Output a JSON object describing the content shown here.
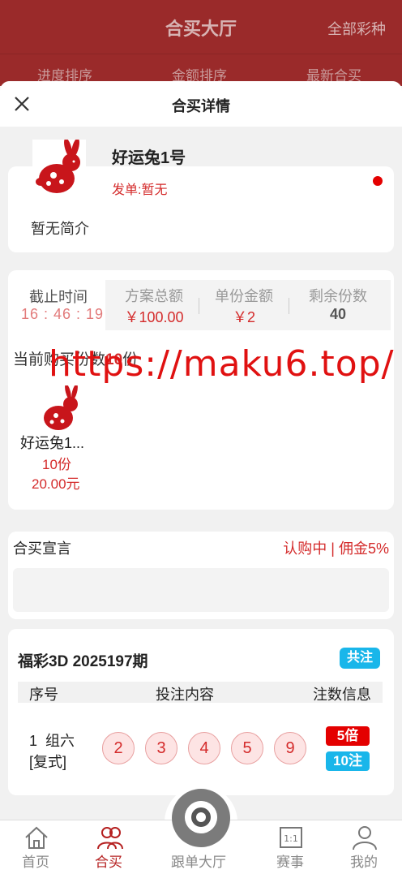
{
  "background": {
    "title": "合买大厅",
    "all_lotteries": "全部彩种",
    "tabs": [
      "进度排序",
      "金额排序",
      "最新合买"
    ]
  },
  "sheet": {
    "title": "合买详情"
  },
  "intro": {
    "name": "好运兔1号",
    "sender": "发单:暂无",
    "description": "暂无简介"
  },
  "stats": {
    "deadline_label": "截止时间",
    "deadline_value": "16 : 46 : 19",
    "total_label": "方案总额",
    "total_value": "￥100.00",
    "unit_label": "单份金额",
    "unit_value": "￥2",
    "remaining_label": "剩余份数",
    "remaining_value": "40"
  },
  "purchase": {
    "prefix": "当前购买份数",
    "count": "10",
    "suffix": "份",
    "member": {
      "name": "好运兔1...",
      "shares": "10份",
      "amount": "20.00元"
    }
  },
  "watermark": "https://maku6.top/",
  "declaration": {
    "title": "合买宣言",
    "status": "认购中 | 佣金5%"
  },
  "ticket": {
    "title": "福彩3D 2025197期",
    "badge": "共注",
    "headers": [
      "序号",
      "投注内容",
      "注数信息"
    ],
    "row": {
      "seq": "1",
      "play": "组六",
      "mode": "[复式]",
      "balls": [
        "2",
        "3",
        "4",
        "5",
        "9"
      ],
      "times": "5倍",
      "notes": "10注"
    }
  },
  "nav": {
    "items": [
      "首页",
      "合买",
      "跟单大厅",
      "赛事",
      "我的"
    ],
    "active": "合买"
  },
  "colors": {
    "brand": "#9a2a2a",
    "accent_red": "#d42b2b",
    "badge_blue": "#19b6ea"
  }
}
